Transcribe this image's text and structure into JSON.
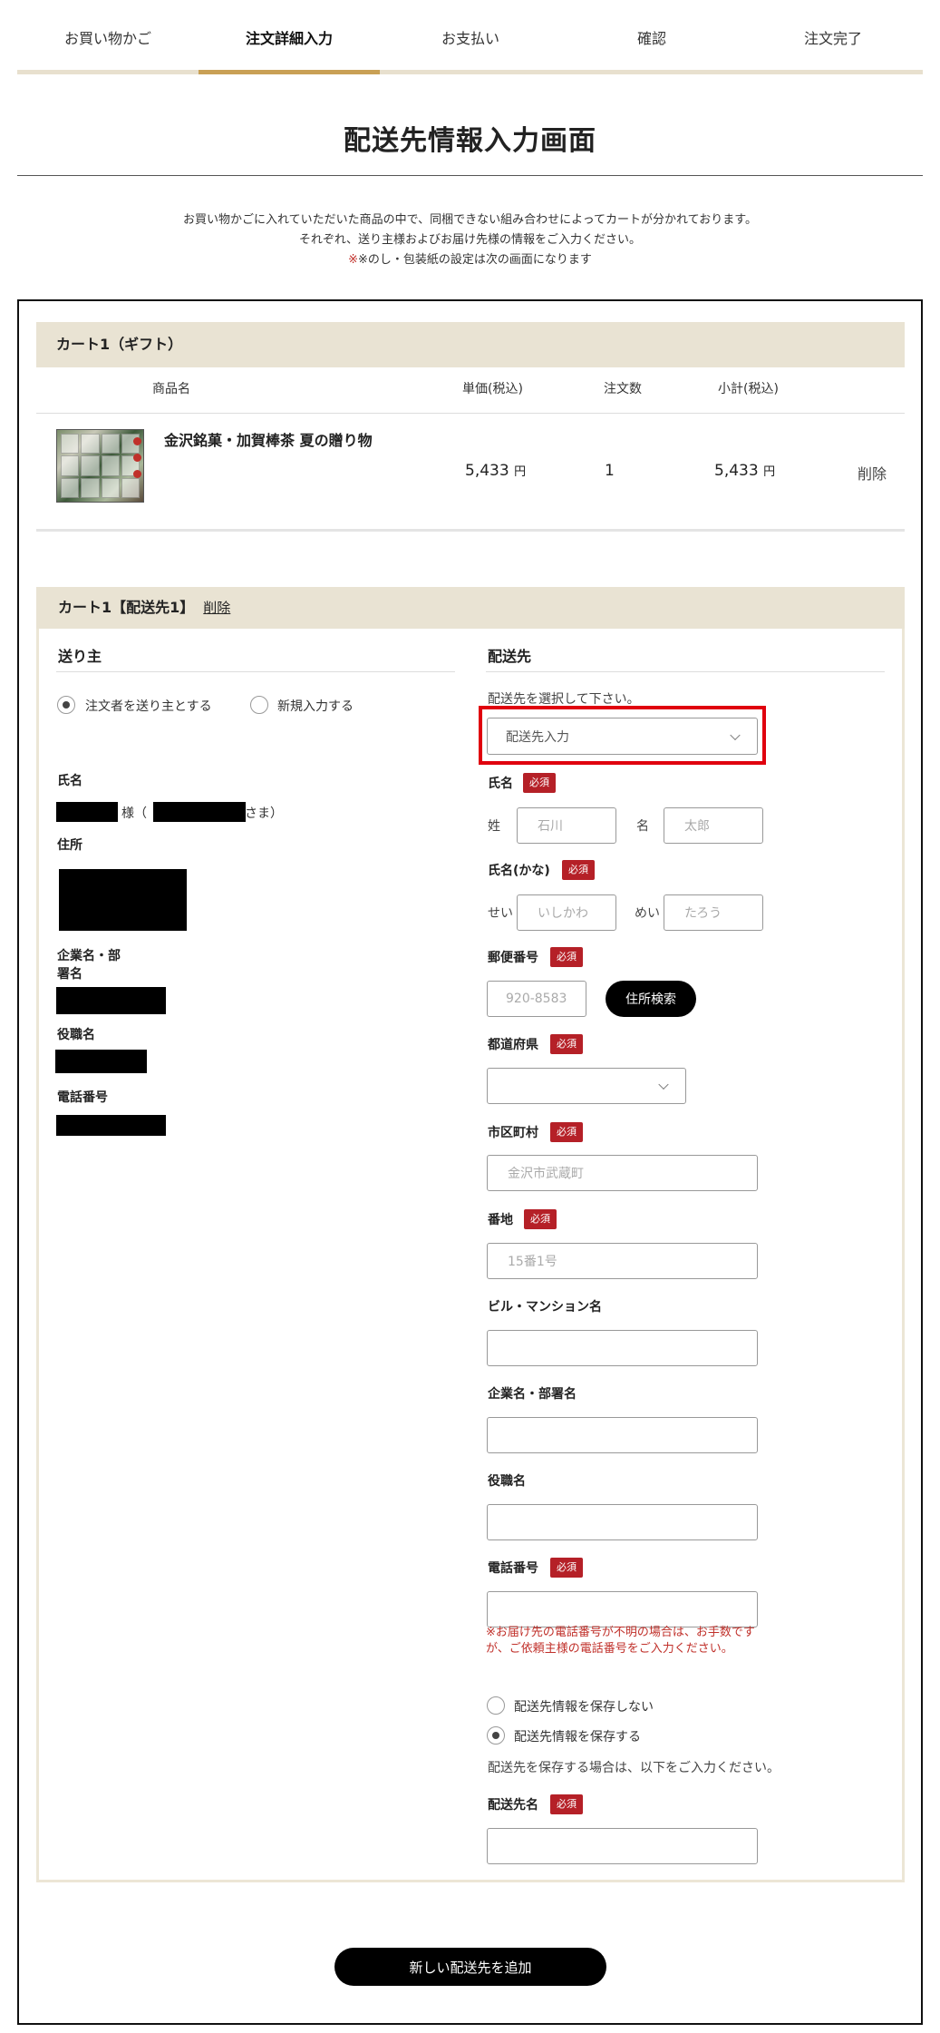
{
  "steps": [
    "お買い物かご",
    "注文詳細入力",
    "お支払い",
    "確認",
    "注文完了"
  ],
  "page_title": "配送先情報入力画面",
  "intro": {
    "line1": "お買い物かごに入れていただいた商品の中で、同梱できない組み合わせによってカートが分かれております。",
    "line2": "それぞれ、送り主様およびお届け先様の情報をご入力ください。",
    "line3": "※のし・包装紙の設定は次の画面になります"
  },
  "cart": {
    "title": "カート1（ギフト）",
    "headers": {
      "name": "商品名",
      "price": "単価(税込)",
      "qty": "注文数",
      "subtotal": "小計(税込)"
    },
    "item": {
      "name": "金沢銘菓・加賀棒茶 夏の贈り物",
      "price": "5,433",
      "currency": "円",
      "qty": "1",
      "subtotal": "5,433",
      "delete": "削除"
    }
  },
  "destination": {
    "header": "カート1【配送先1】",
    "delete": "削除",
    "sender": {
      "title": "送り主",
      "radio_self": "注文者を送り主とする",
      "radio_new": "新規入力する",
      "name_label": "氏名",
      "sama": "様（",
      "sama_close": "さま）",
      "address_label": "住所",
      "company_label_1": "企業名・部",
      "company_label_2": "署名",
      "position_label": "役職名",
      "phone_label": "電話番号"
    },
    "recipient": {
      "title": "配送先",
      "select_prompt": "配送先を選択して下さい。",
      "select_value": "配送先入力",
      "required": "必須",
      "name_label": "氏名",
      "sei_label": "姓",
      "sei_placeholder": "石川",
      "mei_label": "名",
      "mei_placeholder": "太郎",
      "kana_label": "氏名(かな)",
      "sei_kana_label": "せい",
      "sei_kana_placeholder": "いしかわ",
      "mei_kana_label": "めい",
      "mei_kana_placeholder": "たろう",
      "postal_label": "郵便番号",
      "postal_placeholder": "920-8583",
      "address_search": "住所検索",
      "prefecture_label": "都道府県",
      "prefecture_value": "",
      "city_label": "市区町村",
      "city_placeholder": "金沢市武蔵町",
      "street_label": "番地",
      "street_placeholder": "15番1号",
      "building_label": "ビル・マンション名",
      "company_label": "企業名・部署名",
      "position_label": "役職名",
      "phone_label": "電話番号",
      "phone_note": "※お届け先の電話番号が不明の場合は、お手数ですが、ご依頼主様の電話番号をご入力ください。",
      "save_no": "配送先情報を保存しない",
      "save_yes": "配送先情報を保存する",
      "save_note": "配送先を保存する場合は、以下をご入力ください。",
      "dest_name_label": "配送先名"
    }
  },
  "add_destination": "新しい配送先を追加",
  "colors": {
    "accent": "#c9a055",
    "required": "#b52027",
    "header_bg": "#e9e3d3",
    "highlight": "#e0000e"
  }
}
